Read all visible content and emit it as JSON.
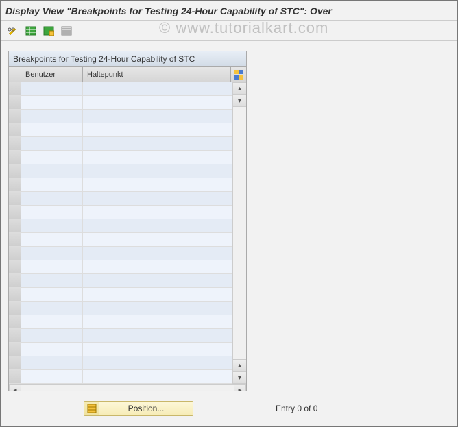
{
  "window": {
    "title": "Display View \"Breakpoints for Testing 24-Hour Capability of STC\": Over"
  },
  "toolbar": {
    "icons": [
      "pencil-glasses-icon",
      "table-green-icon",
      "table-save-icon",
      "table-list-icon"
    ]
  },
  "watermark": "© www.tutorialkart.com",
  "table": {
    "title": "Breakpoints for Testing 24-Hour Capability of STC",
    "columns": {
      "user": "Benutzer",
      "breakpoint": "Haltepunkt"
    },
    "config_icon": "table-settings-icon",
    "rows": [
      {
        "user": "",
        "breakpoint": ""
      },
      {
        "user": "",
        "breakpoint": ""
      },
      {
        "user": "",
        "breakpoint": ""
      },
      {
        "user": "",
        "breakpoint": ""
      },
      {
        "user": "",
        "breakpoint": ""
      },
      {
        "user": "",
        "breakpoint": ""
      },
      {
        "user": "",
        "breakpoint": ""
      },
      {
        "user": "",
        "breakpoint": ""
      },
      {
        "user": "",
        "breakpoint": ""
      },
      {
        "user": "",
        "breakpoint": ""
      },
      {
        "user": "",
        "breakpoint": ""
      },
      {
        "user": "",
        "breakpoint": ""
      },
      {
        "user": "",
        "breakpoint": ""
      },
      {
        "user": "",
        "breakpoint": ""
      },
      {
        "user": "",
        "breakpoint": ""
      },
      {
        "user": "",
        "breakpoint": ""
      },
      {
        "user": "",
        "breakpoint": ""
      },
      {
        "user": "",
        "breakpoint": ""
      },
      {
        "user": "",
        "breakpoint": ""
      },
      {
        "user": "",
        "breakpoint": ""
      },
      {
        "user": "",
        "breakpoint": ""
      },
      {
        "user": "",
        "breakpoint": ""
      }
    ]
  },
  "footer": {
    "position_label": "Position...",
    "entry_text": "Entry 0 of 0"
  }
}
